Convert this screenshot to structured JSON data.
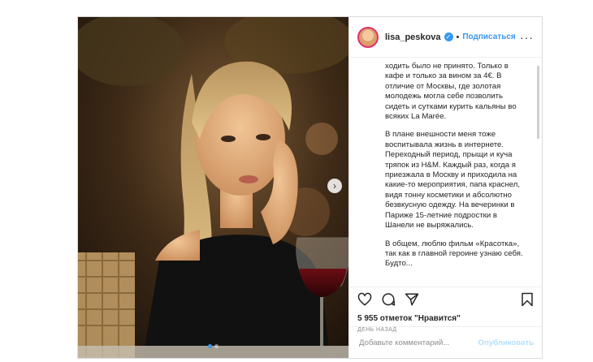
{
  "post": {
    "username": "lisa_peskova",
    "verified_icon": "verified-badge-icon",
    "separator": "•",
    "follow_label": "Подписаться",
    "more_icon": "more-options-icon",
    "more_glyph": "···",
    "caption_paragraphs": [
      "ходить было не принято. Только в кафе и только за вином за 4€. В отличие от Москвы, где золотая молодежь могла себе позволить сидеть и сутками курить кальяны во всяких La Marée.",
      "В плане внешности меня тоже воспитывала жизнь в интернете. Переходный период, прыщи и куча тряпок из H&M. Каждый раз, когда я приезжала в Москву и приходила на какие-то мероприятия, папа краснел, видя тонну косметики и абсолютно безвкусную одежду. На вечеринки в Париже 15-летние подростки в Шанели не выряжались.",
      "В общем, люблю фильм «Красотка», так как в главной героине узнаю себя. Будто..."
    ],
    "likes_text": "5 955 отметок \"Нравится\"",
    "time_text": "ДЕНЬ НАЗАД",
    "comment_placeholder": "Добавьте комментарий...",
    "publish_label": "Опубликовать",
    "next_arrow_glyph": "›",
    "carousel": {
      "count": 2,
      "active_index": 0
    }
  },
  "colors": {
    "accent": "#3897f0",
    "publish_disabled": "#b2dffc",
    "text": "#262626",
    "muted": "#8e8e8e",
    "border": "#dbdbdb"
  }
}
